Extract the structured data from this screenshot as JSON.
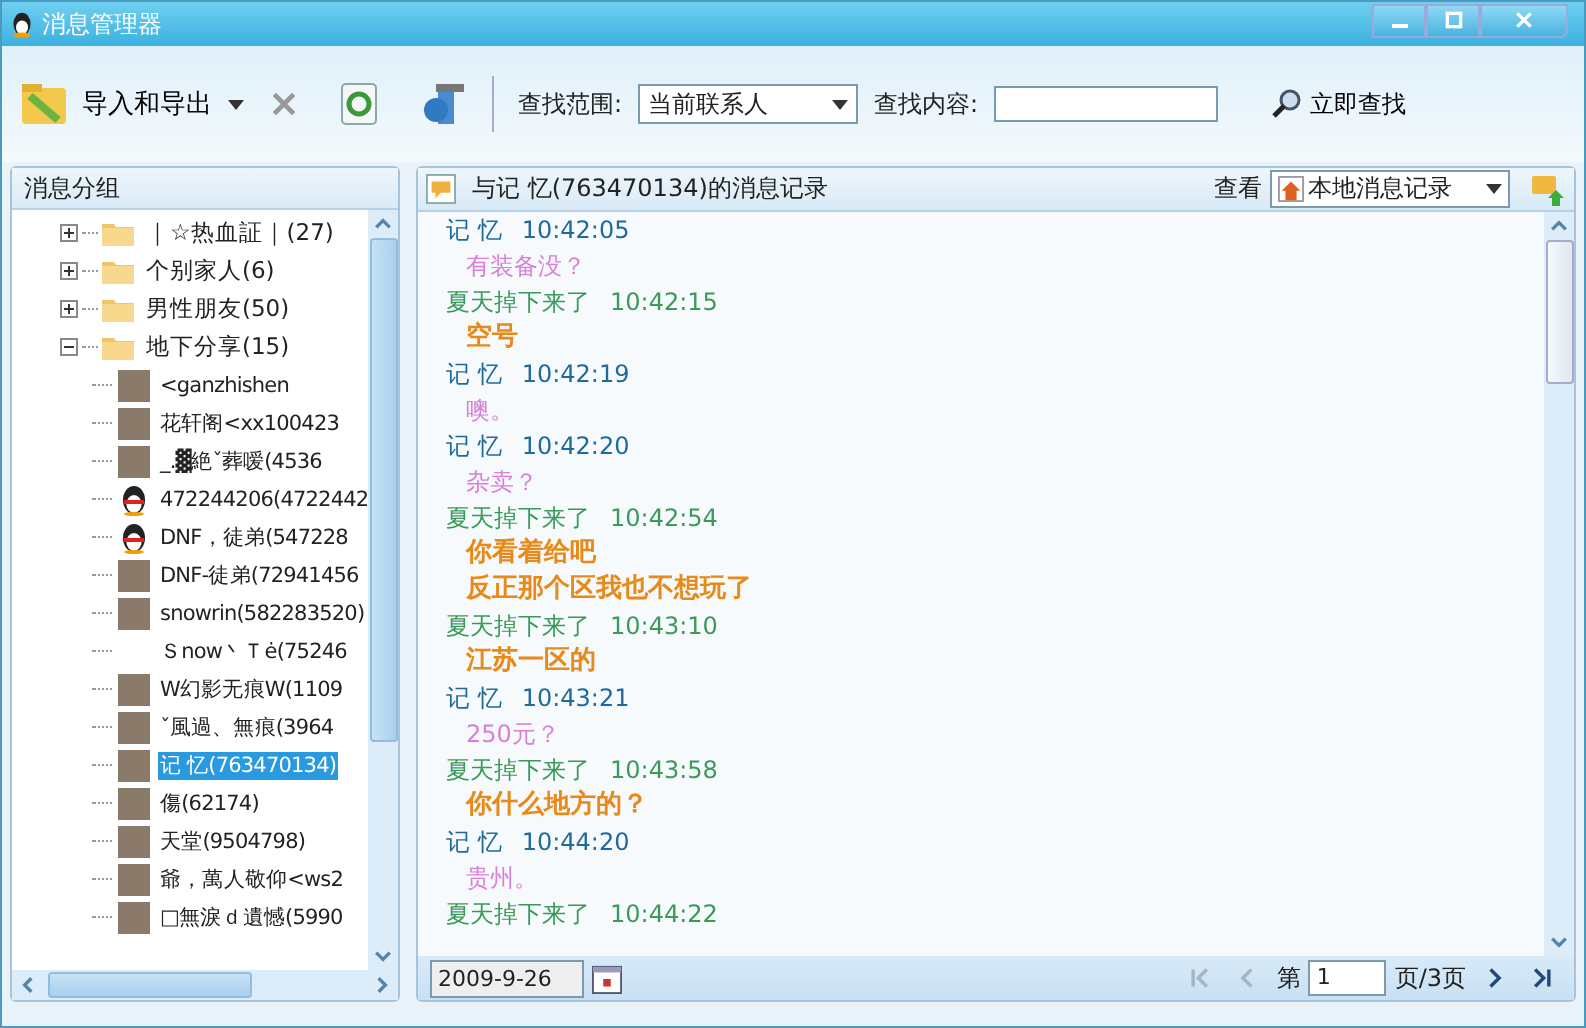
{
  "window": {
    "title": "消息管理器"
  },
  "toolbar": {
    "import_export": "导入和导出",
    "scope_label": "查找范围:",
    "scope_value": "当前联系人",
    "content_label": "查找内容:",
    "search_button": "立即查找"
  },
  "sidebar": {
    "title": "消息分组",
    "tree": [
      {
        "label": "｜☆热血証｜(27)",
        "expanded": false
      },
      {
        "label": "个别家人(6)",
        "expanded": false
      },
      {
        "label": "男性朋友(50)",
        "expanded": false
      },
      {
        "label": "地下分享(15)",
        "expanded": true,
        "children": [
          {
            "label": "<ganzhishen",
            "kind": "photo",
            "selected": false
          },
          {
            "label": "花轩阁<xx100423",
            "kind": "photo",
            "selected": false
          },
          {
            "label": "_.▓絶ˇ葬嗳(4536",
            "kind": "photo",
            "selected": false
          },
          {
            "label": "472244206(4722442",
            "kind": "penguin",
            "selected": false
          },
          {
            "label": "DNF，徒弟(547228",
            "kind": "penguin",
            "selected": false
          },
          {
            "label": "DNF-徒弟(72941456",
            "kind": "photo",
            "selected": false
          },
          {
            "label": "snowrin(582283520)",
            "kind": "photo",
            "selected": false
          },
          {
            "label": "Ｓnow丶Ｔė(75246",
            "kind": "none",
            "selected": false
          },
          {
            "label": "W幻影无痕W(1109",
            "kind": "photo",
            "selected": false
          },
          {
            "label": "ˇ風過、無痕(3964",
            "kind": "photo",
            "selected": false
          },
          {
            "label": "记 忆(763470134)",
            "kind": "photo",
            "selected": true
          },
          {
            "label": "傷(62174)",
            "kind": "photo",
            "selected": false
          },
          {
            "label": "天堂(9504798)",
            "kind": "photo",
            "selected": false
          },
          {
            "label": "爺，萬人敬仰<ws2",
            "kind": "photo",
            "selected": false
          },
          {
            "label": "□無淚ｄ遺憾(5990",
            "kind": "photo",
            "selected": false
          }
        ]
      }
    ]
  },
  "chat": {
    "title": "与记 忆(763470134)的消息记录",
    "view_label": "查看",
    "view_value": "本地消息记录",
    "messages": [
      {
        "kind": "them",
        "sender": "记 忆",
        "time": "10:42:05",
        "lines": [
          "有装备没？"
        ]
      },
      {
        "kind": "me",
        "sender": "夏天掉下来了",
        "time": "10:42:15",
        "lines": [
          "空号"
        ]
      },
      {
        "kind": "them",
        "sender": "记 忆",
        "time": "10:42:19",
        "lines": [
          "噢。"
        ]
      },
      {
        "kind": "them",
        "sender": "记 忆",
        "time": "10:42:20",
        "lines": [
          "杂卖？"
        ]
      },
      {
        "kind": "me",
        "sender": "夏天掉下来了",
        "time": "10:42:54",
        "lines": [
          "你看着给吧",
          "反正那个区我也不想玩了"
        ]
      },
      {
        "kind": "me",
        "sender": "夏天掉下来了",
        "time": "10:43:10",
        "lines": [
          "江苏一区的"
        ]
      },
      {
        "kind": "them",
        "sender": "记 忆",
        "time": "10:43:21",
        "lines": [
          "250元？"
        ]
      },
      {
        "kind": "me",
        "sender": "夏天掉下来了",
        "time": "10:43:58",
        "lines": [
          "你什么地方的？"
        ]
      },
      {
        "kind": "them",
        "sender": "记 忆",
        "time": "10:44:20",
        "lines": [
          "贵州。"
        ]
      },
      {
        "kind": "me",
        "sender": "夏天掉下来了",
        "time": "10:44:22"
      }
    ]
  },
  "footer": {
    "date": "2009-9-26",
    "page_prefix": "第",
    "page": "1",
    "page_suffix": "页/3页",
    "pager": [
      {
        "kind": "first",
        "disabled": true
      },
      {
        "kind": "prev",
        "disabled": true
      },
      {
        "kind": "next",
        "disabled": false
      },
      {
        "kind": "last",
        "disabled": false
      }
    ]
  }
}
